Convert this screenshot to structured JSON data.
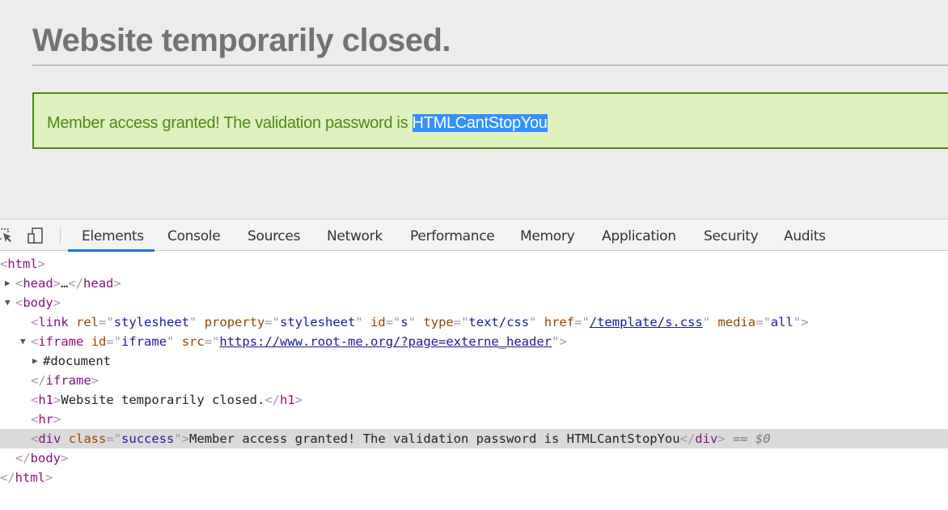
{
  "page": {
    "heading": "Website temporarily closed.",
    "success_text": "Member access granted! The validation password is ",
    "success_selected": "HTMLCantStopYou",
    "colors": {
      "background": "#ececec",
      "heading": "#737373",
      "success_bg": "#e0f1c0",
      "success_border": "#4f8a10",
      "selection": "#3390ff"
    }
  },
  "devtools": {
    "icons": [
      "inspect-element-icon",
      "device-toolbar-icon"
    ],
    "tabs": [
      {
        "label": "Elements",
        "active": true
      },
      {
        "label": "Console"
      },
      {
        "label": "Sources"
      },
      {
        "label": "Network"
      },
      {
        "label": "Performance"
      },
      {
        "label": "Memory"
      },
      {
        "label": "Application"
      },
      {
        "label": "Security"
      },
      {
        "label": "Audits"
      }
    ],
    "tree": [
      {
        "indent": 0,
        "tokens": [
          [
            "br",
            "<"
          ],
          [
            "tg",
            "html"
          ],
          [
            "br",
            ">"
          ]
        ]
      },
      {
        "indent": 1,
        "toggle": "collapsed",
        "tokens": [
          [
            "br",
            "<"
          ],
          [
            "tg",
            "head"
          ],
          [
            "br",
            ">"
          ],
          [
            "tx",
            "…"
          ],
          [
            "br",
            "</"
          ],
          [
            "tg",
            "head"
          ],
          [
            "br",
            ">"
          ]
        ]
      },
      {
        "indent": 1,
        "toggle": "expanded",
        "tokens": [
          [
            "br",
            "<"
          ],
          [
            "tg",
            "body"
          ],
          [
            "br",
            ">"
          ]
        ]
      },
      {
        "indent": 2,
        "tokens": [
          [
            "br",
            "<"
          ],
          [
            "tg",
            "link"
          ],
          [
            "tx",
            " "
          ],
          [
            "an",
            "rel"
          ],
          [
            "br",
            "=\""
          ],
          [
            "av",
            "stylesheet"
          ],
          [
            "br",
            "\""
          ],
          [
            "tx",
            " "
          ],
          [
            "an",
            "property"
          ],
          [
            "br",
            "=\""
          ],
          [
            "av",
            "stylesheet"
          ],
          [
            "br",
            "\""
          ],
          [
            "tx",
            " "
          ],
          [
            "an",
            "id"
          ],
          [
            "br",
            "=\""
          ],
          [
            "av",
            "s"
          ],
          [
            "br",
            "\""
          ],
          [
            "tx",
            " "
          ],
          [
            "an",
            "type"
          ],
          [
            "br",
            "=\""
          ],
          [
            "av",
            "text/css"
          ],
          [
            "br",
            "\""
          ],
          [
            "tx",
            " "
          ],
          [
            "an",
            "href"
          ],
          [
            "br",
            "=\""
          ],
          [
            "lk",
            "/template/s.css"
          ],
          [
            "br",
            "\""
          ],
          [
            "tx",
            " "
          ],
          [
            "an",
            "media"
          ],
          [
            "br",
            "=\""
          ],
          [
            "av",
            "all"
          ],
          [
            "br",
            "\">"
          ]
        ]
      },
      {
        "indent": 2,
        "toggle": "expanded",
        "tokens": [
          [
            "br",
            "<"
          ],
          [
            "tg",
            "iframe"
          ],
          [
            "tx",
            " "
          ],
          [
            "an",
            "id"
          ],
          [
            "br",
            "=\""
          ],
          [
            "av",
            "iframe"
          ],
          [
            "br",
            "\""
          ],
          [
            "tx",
            " "
          ],
          [
            "an",
            "src"
          ],
          [
            "br",
            "=\""
          ],
          [
            "lk",
            "https://www.root-me.org/?page=externe_header"
          ],
          [
            "br",
            "\">"
          ]
        ]
      },
      {
        "indent": 3,
        "toggle": "collapsed",
        "tokens": [
          [
            "tx",
            "#document"
          ]
        ]
      },
      {
        "indent": 2,
        "tokens": [
          [
            "br",
            "</"
          ],
          [
            "tg",
            "iframe"
          ],
          [
            "br",
            ">"
          ]
        ]
      },
      {
        "indent": 2,
        "tokens": [
          [
            "br",
            "<"
          ],
          [
            "tg",
            "h1"
          ],
          [
            "br",
            ">"
          ],
          [
            "tx",
            "Website temporarily closed."
          ],
          [
            "br",
            "</"
          ],
          [
            "tg",
            "h1"
          ],
          [
            "br",
            ">"
          ]
        ]
      },
      {
        "indent": 2,
        "tokens": [
          [
            "br",
            "<"
          ],
          [
            "tg",
            "hr"
          ],
          [
            "br",
            ">"
          ]
        ]
      },
      {
        "indent": 2,
        "selected": true,
        "tokens": [
          [
            "br",
            "<"
          ],
          [
            "tg",
            "div"
          ],
          [
            "tx",
            " "
          ],
          [
            "an",
            "class"
          ],
          [
            "br",
            "=\""
          ],
          [
            "av",
            "success"
          ],
          [
            "br",
            "\">"
          ],
          [
            "tx",
            "Member access granted! The validation password is HTMLCantStopYou"
          ],
          [
            "br",
            "</"
          ],
          [
            "tg",
            "div"
          ],
          [
            "br",
            ">"
          ],
          [
            "hint",
            " == $0"
          ]
        ]
      },
      {
        "indent": 1,
        "tokens": [
          [
            "br",
            "</"
          ],
          [
            "tg",
            "body"
          ],
          [
            "br",
            ">"
          ]
        ]
      },
      {
        "indent": 0,
        "tokens": [
          [
            "br",
            "</"
          ],
          [
            "tg",
            "html"
          ],
          [
            "br",
            ">"
          ]
        ]
      }
    ]
  }
}
